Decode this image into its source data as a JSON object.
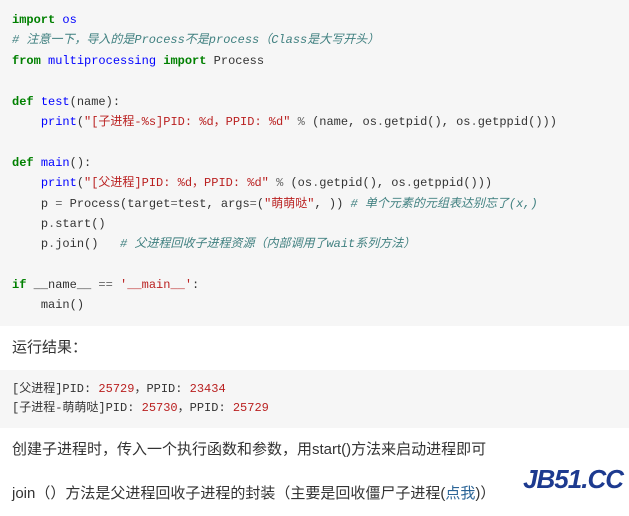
{
  "code": {
    "l1": {
      "kw1": "import",
      "mod": "os"
    },
    "l2": {
      "cmt": "# 注意一下，导入的是Process不是process（Class是大写开头）"
    },
    "l3": {
      "kw1": "from",
      "mod": "multiprocessing",
      "kw2": "import",
      "cls": "Process"
    },
    "l4": {
      "kw1": "def",
      "fn": "test",
      "args": "(name):"
    },
    "l5": {
      "fn": "print",
      "open": "(",
      "str": "\"[子进程-%s]PID: %d，PPID: %d\"",
      "op": "%",
      "rest1": "(name, os",
      "op2": ".",
      "rest2": "getpid(), os",
      "op3": ".",
      "rest3": "getppid()))"
    },
    "l6": {
      "kw1": "def",
      "fn": "main",
      "args": "():"
    },
    "l7": {
      "fn": "print",
      "open": "(",
      "str": "\"[父进程]PID: %d，PPID: %d\"",
      "op": "%",
      "rest1": "(os",
      "op2": ".",
      "rest2": "getpid(), os",
      "op3": ".",
      "rest3": "getppid()))"
    },
    "l8": {
      "lhs": "p ",
      "eq": "=",
      "sp": " Process(target",
      "eq2": "=",
      "rest": "test, args",
      "eq3": "=",
      "open": "(",
      "str": "\"萌萌哒\"",
      "close": ", )) ",
      "cmt": "# 单个元素的元组表达别忘了(x,)"
    },
    "l9": {
      "txt1": "p",
      "op": ".",
      "txt2": "start()"
    },
    "l10": {
      "txt1": "p",
      "op": ".",
      "txt2": "join()",
      "sp": "   ",
      "cmt": "# 父进程回收子进程资源（内部调用了wait系列方法）"
    },
    "l11": {
      "kw1": "if",
      "name": "__name__",
      "eq": "==",
      "str": "'__main__'",
      "colon": ":"
    },
    "l12": {
      "txt": "main()"
    }
  },
  "prose": {
    "result_heading": "运行结果：",
    "p1": "创建子进程时，传入一个执行函数和参数，用start()方法来启动进程即可",
    "p2a": "join（）方法是父进程回收子进程的封装（主要是回收僵尸子进程(",
    "p2link": "点我",
    "p2b": ")）"
  },
  "output": {
    "l1a": "[父进程]PID: ",
    "l1n1": "25729",
    "l1b": "，PPID: ",
    "l1n2": "23434",
    "l2a": "[子进程-萌萌哒]PID: ",
    "l2n1": "25730",
    "l2b": "，PPID: ",
    "l2n2": "25729"
  },
  "watermark": "JB51.CC"
}
